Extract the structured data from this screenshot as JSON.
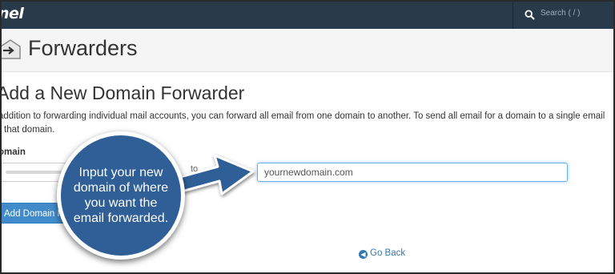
{
  "app": {
    "logo_text": "nel",
    "search_placeholder": "Search ( / )"
  },
  "page": {
    "title": "Forwarders",
    "section_title": "Add a New Domain Forwarder",
    "description_line1": "addition to forwarding individual mail accounts, you can forward all email from one domain to another. To send all email for a domain to a single email",
    "description_line2": "r that domain."
  },
  "form": {
    "domain_label": "omain",
    "to_label": "to",
    "destination_value": "yournewdomain.com",
    "add_button_label": "Add Domain Forwarder"
  },
  "footer": {
    "go_back_label": "Go Back"
  },
  "callout": {
    "text": "Input your new domain of where you want the email forwarded.",
    "color": "#2f5f96"
  },
  "colors": {
    "topbar": "#293a4a",
    "primary_button": "#428bca",
    "link": "#3278b3"
  }
}
